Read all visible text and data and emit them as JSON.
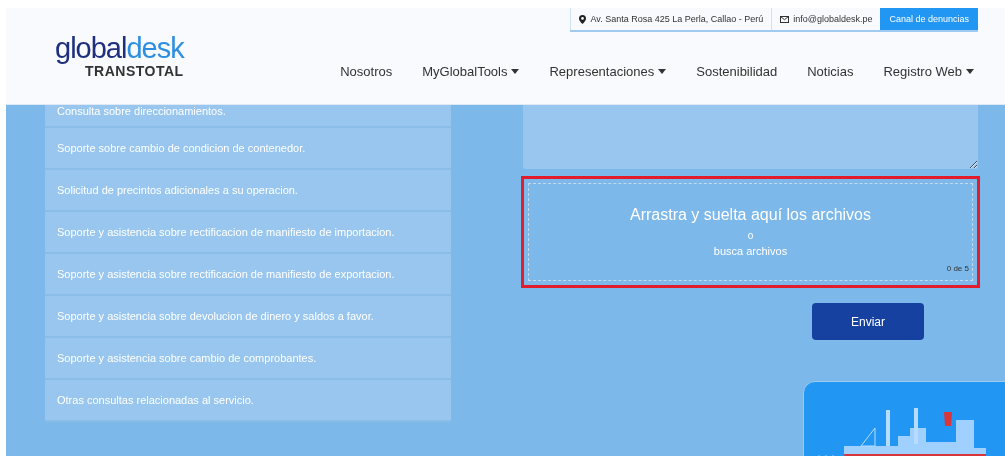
{
  "header": {
    "logo": {
      "primary": "global",
      "secondary": "desk",
      "tagline": "TRANSTOTAL"
    },
    "contact_bar": {
      "address": "Av. Santa Rosa 425 La Perla, Callao - Perú",
      "email": "info@globaldesk.pe",
      "button": "Canal de denuncias"
    },
    "nav": [
      {
        "label": "Nosotros",
        "has_menu": false
      },
      {
        "label": "MyGlobalTools",
        "has_menu": true
      },
      {
        "label": "Representaciones",
        "has_menu": true
      },
      {
        "label": "Sostenibilidad",
        "has_menu": false
      },
      {
        "label": "Noticias",
        "has_menu": false
      },
      {
        "label": "Registro Web",
        "has_menu": true
      }
    ]
  },
  "services": [
    "Consulta sobre direccionamientos.",
    "Soporte sobre cambio de condicion de contenedor.",
    "Solicitud de precintos adicionales a su operacion.",
    "Soporte y asistencia sobre rectificacion de manifiesto de importacion.",
    "Soporte y asistencia sobre rectificacion de manifiesto de exportacion.",
    "Soporte y asistencia sobre devolucion de dinero y saldos a favor.",
    "Soporte y asistencia sobre cambio de comprobantes.",
    "Otras consultas relacionadas al servicio."
  ],
  "upload": {
    "title": "Arrastra y suelta aquí los archivos",
    "separator": "o",
    "browse": "busca archivos",
    "counter": "0 de 5",
    "highlighted": true
  },
  "submit": "Enviar"
}
